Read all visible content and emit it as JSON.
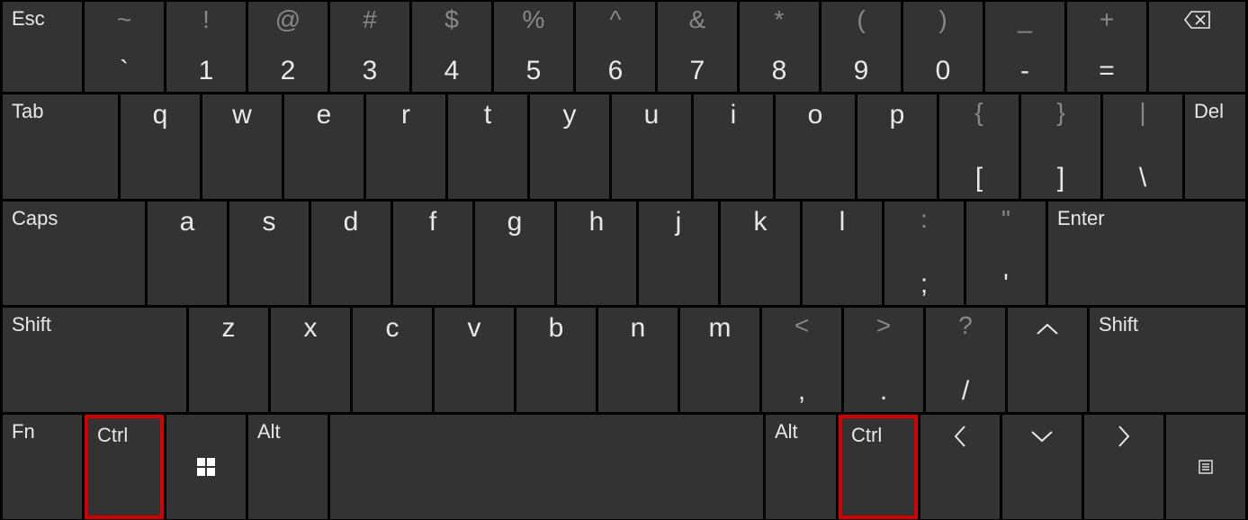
{
  "row1": {
    "esc": "Esc",
    "keys": [
      {
        "shift": "~",
        "main": "`"
      },
      {
        "shift": "!",
        "main": "1"
      },
      {
        "shift": "@",
        "main": "2"
      },
      {
        "shift": "#",
        "main": "3"
      },
      {
        "shift": "$",
        "main": "4"
      },
      {
        "shift": "%",
        "main": "5"
      },
      {
        "shift": "^",
        "main": "6"
      },
      {
        "shift": "&",
        "main": "7"
      },
      {
        "shift": "*",
        "main": "8"
      },
      {
        "shift": "(",
        "main": "9"
      },
      {
        "shift": ")",
        "main": "0"
      },
      {
        "shift": "_",
        "main": "-"
      },
      {
        "shift": "+",
        "main": "="
      }
    ]
  },
  "row2": {
    "tab": "Tab",
    "letters": [
      "q",
      "w",
      "e",
      "r",
      "t",
      "y",
      "u",
      "i",
      "o",
      "p"
    ],
    "sym": [
      {
        "shift": "{",
        "main": "["
      },
      {
        "shift": "}",
        "main": "]"
      },
      {
        "shift": "|",
        "main": "\\"
      }
    ],
    "del": "Del"
  },
  "row3": {
    "caps": "Caps",
    "letters": [
      "a",
      "s",
      "d",
      "f",
      "g",
      "h",
      "j",
      "k",
      "l"
    ],
    "sym": [
      {
        "shift": ":",
        "main": ";"
      },
      {
        "shift": "\"",
        "main": "'"
      }
    ],
    "enter": "Enter"
  },
  "row4": {
    "shiftL": "Shift",
    "letters": [
      "z",
      "x",
      "c",
      "v",
      "b",
      "n",
      "m"
    ],
    "sym": [
      {
        "shift": "<",
        "main": ","
      },
      {
        "shift": ">",
        "main": "."
      },
      {
        "shift": "?",
        "main": "/"
      }
    ],
    "shiftR": "Shift"
  },
  "row5": {
    "fn": "Fn",
    "ctrlL": "Ctrl",
    "alt": "Alt",
    "altR": "Alt",
    "ctrlR": "Ctrl"
  }
}
